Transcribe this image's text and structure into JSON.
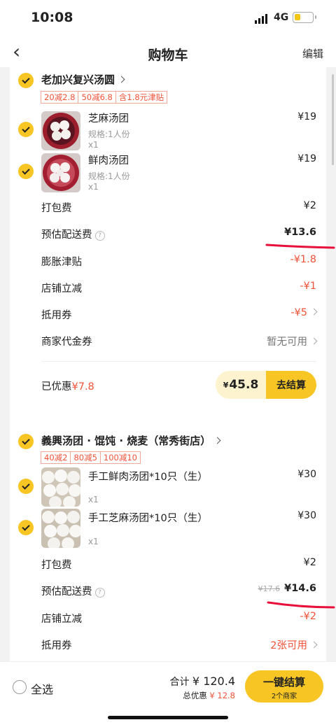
{
  "status": {
    "time": "10:08",
    "network": "4G"
  },
  "nav": {
    "title": "购物车",
    "edit": "编辑"
  },
  "store1": {
    "name": "老加兴复兴汤圆",
    "tags": [
      "20减2.8",
      "50减6.8",
      "含1.8元津贴"
    ],
    "items": [
      {
        "name": "芝麻汤团",
        "spec": "规格:1人份",
        "qty": "x1",
        "price": "¥19"
      },
      {
        "name": "鲜肉汤团",
        "spec": "规格:1人份",
        "qty": "x1",
        "price": "¥19"
      }
    ],
    "fees": {
      "packing_label": "打包费",
      "packing_value": "¥2",
      "delivery_label": "预估配送费",
      "delivery_value": "¥13.6",
      "subsidy_label": "膨胀津贴",
      "subsidy_value": "-¥1.8",
      "store_discount_label": "店铺立减",
      "store_discount_value": "-¥1",
      "coupon_label": "抵用券",
      "coupon_value": "-¥5",
      "voucher_label": "商家代金券",
      "voucher_value": "暂无可用"
    },
    "saved_label": "已优惠",
    "saved_value": "¥7.8",
    "pay_currency": "¥",
    "pay_amount": "45.8",
    "pay_button": "去结算"
  },
  "store2": {
    "name": "義興汤团 · 馄饨 · 烧麦（常秀街店）",
    "tags": [
      "40减2",
      "80减5",
      "100减10"
    ],
    "items": [
      {
        "name": "手工鲜肉汤团*10只（生）",
        "qty": "x1",
        "price": "¥30"
      },
      {
        "name": "手工芝麻汤团*10只（生）",
        "qty": "x1",
        "price": "¥30"
      }
    ],
    "fees": {
      "packing_label": "打包费",
      "packing_value": "¥2",
      "delivery_label": "预估配送费",
      "delivery_original": "¥17.6",
      "delivery_value": "¥14.6",
      "store_discount_label": "店铺立减",
      "store_discount_value": "-¥2",
      "coupon_label": "抵用券",
      "coupon_value": "2张可用"
    }
  },
  "bottom": {
    "select_all": "全选",
    "total_label": "合计",
    "total_value": "¥ 120.4",
    "discount_label": "总优惠",
    "discount_value": "¥ 12.8",
    "checkout": "一键结算",
    "checkout_sub": "2个商家"
  },
  "colors": {
    "accent": "#f7c624",
    "red": "#f0533a",
    "annotation": "#e8103a"
  },
  "icons": [
    "back-chevron-icon",
    "chevron-right-icon",
    "question-icon",
    "check-icon"
  ]
}
